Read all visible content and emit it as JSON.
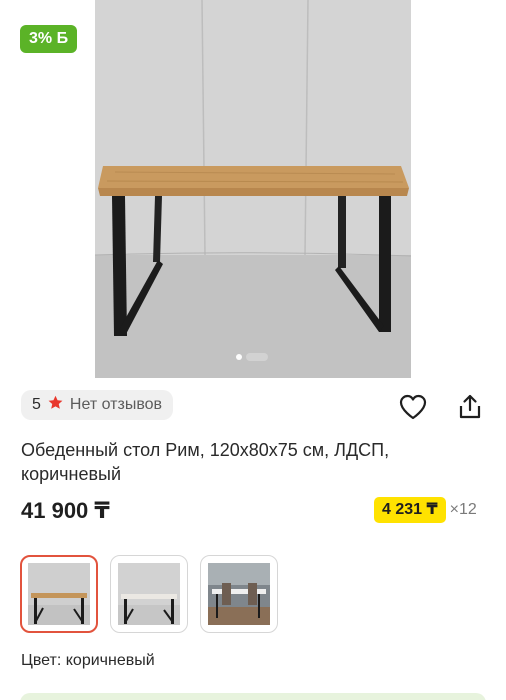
{
  "product": {
    "cashback_badge": "3% Б",
    "rating_value": "5",
    "reviews_text": "Нет отзывов",
    "title": "Обеденный стол Рим, 120х80х75 см, ЛДСП, коричневый",
    "price": "41 900 ₸",
    "installment_amount": "4 231 ₸",
    "installment_months": "×12",
    "color_label": "Цвет: коричневый",
    "gallery_total": 2,
    "gallery_current": 1
  },
  "variants": [
    {
      "name": "brown",
      "selected": true
    },
    {
      "name": "white",
      "selected": false
    },
    {
      "name": "interior",
      "selected": false
    }
  ],
  "icons": [
    "star-icon",
    "heart-icon",
    "share-icon"
  ],
  "colors": {
    "cashback_green": "#5bb327",
    "installment_yellow": "#ffe200",
    "selected_border": "#e2533d",
    "star_red": "#e8372c"
  }
}
